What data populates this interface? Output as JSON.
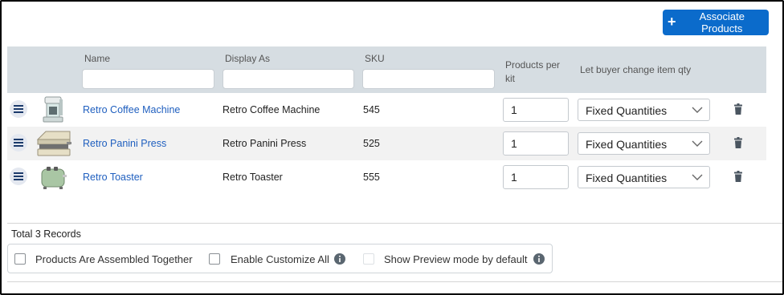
{
  "toolbar": {
    "associate_label": "Associate Products"
  },
  "table": {
    "columns": {
      "name": "Name",
      "display_as": "Display As",
      "sku": "SKU",
      "products_per_kit": "Products per kit",
      "let_buyer_change": "Let buyer change item qty"
    },
    "rows": [
      {
        "name": "Retro Coffee Machine",
        "display_as": "Retro Coffee Machine",
        "sku": "545",
        "qty": "1",
        "qty_mode": "Fixed Quantities",
        "thumb_icon": "coffee-machine-icon"
      },
      {
        "name": "Retro Panini Press",
        "display_as": "Retro Panini Press",
        "sku": "525",
        "qty": "1",
        "qty_mode": "Fixed Quantities",
        "thumb_icon": "panini-press-icon"
      },
      {
        "name": "Retro Toaster",
        "display_as": "Retro Toaster",
        "sku": "555",
        "qty": "1",
        "qty_mode": "Fixed Quantities",
        "thumb_icon": "toaster-icon"
      }
    ]
  },
  "footer": {
    "total": "Total 3 Records",
    "options": {
      "assembled": "Products Are Assembled Together",
      "customize": "Enable Customize All",
      "preview": "Show Preview mode by default"
    }
  },
  "colors": {
    "accent": "#0b6bcb",
    "link": "#1f5fbf",
    "header_bg": "#d6dde2",
    "row_alt_bg": "#f2f2f2"
  }
}
